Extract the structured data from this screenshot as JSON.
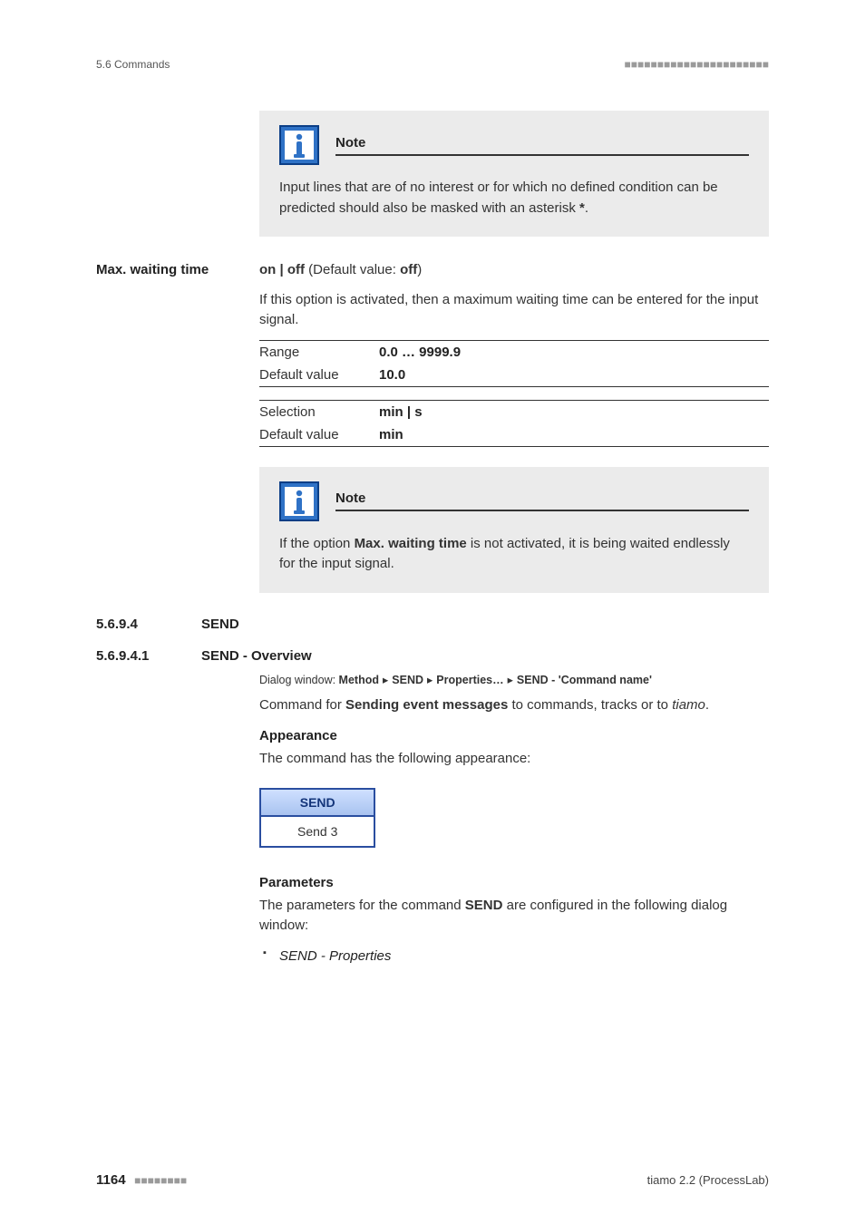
{
  "header": {
    "section_ref": "5.6 Commands",
    "dashes": "■■■■■■■■■■■■■■■■■■■■■■"
  },
  "note1": {
    "title": "Note",
    "body_pre": "Input lines that are of no interest or for which no defined condition can be predicted should also be masked with an asterisk ",
    "body_bold": "*",
    "body_post": "."
  },
  "max_wait": {
    "label": "Max. waiting time",
    "onoff_pre": "on | off",
    "onoff_mid": " (Default value: ",
    "onoff_bold": "off",
    "onoff_post": ")",
    "desc": "If this option is activated, then a maximum waiting time can be entered for the input signal.",
    "rows": [
      {
        "label": "Range",
        "value": "0.0 … 9999.9"
      },
      {
        "label": "Default value",
        "value": "10.0"
      }
    ],
    "rows2": [
      {
        "label": "Selection",
        "value": "min | s"
      },
      {
        "label": "Default value",
        "value": "min"
      }
    ]
  },
  "note2": {
    "title": "Note",
    "body_pre": "If the option ",
    "body_bold": "Max. waiting time",
    "body_post": " is not activated, it is being waited endlessly for the input signal."
  },
  "sec_send": {
    "num": "5.6.9.4",
    "title": "SEND"
  },
  "sec_overview": {
    "num": "5.6.9.4.1",
    "title": "SEND - Overview"
  },
  "dlg": {
    "prefix": "Dialog window: ",
    "p1": "Method",
    "p2": "SEND",
    "p3": "Properties…",
    "p4": "SEND - 'Command name'",
    "sep": "▸"
  },
  "overview": {
    "cmd_pre": "Command for ",
    "cmd_bold": "Sending event messages",
    "cmd_mid": " to commands, tracks or to ",
    "cmd_ital": "tiamo",
    "cmd_post": "."
  },
  "appearance": {
    "title": "Appearance",
    "intro": "The command has the following appearance:",
    "widget_top": "SEND",
    "widget_bot": "Send 3"
  },
  "parameters": {
    "title": "Parameters",
    "intro_pre": "The parameters for the command ",
    "intro_bold": "SEND",
    "intro_post": " are configured in the following dialog window:",
    "items": [
      "SEND - Properties"
    ]
  },
  "footer": {
    "page": "1164",
    "dashes": "■■■■■■■■",
    "product": "tiamo 2.2 (ProcessLab)"
  }
}
